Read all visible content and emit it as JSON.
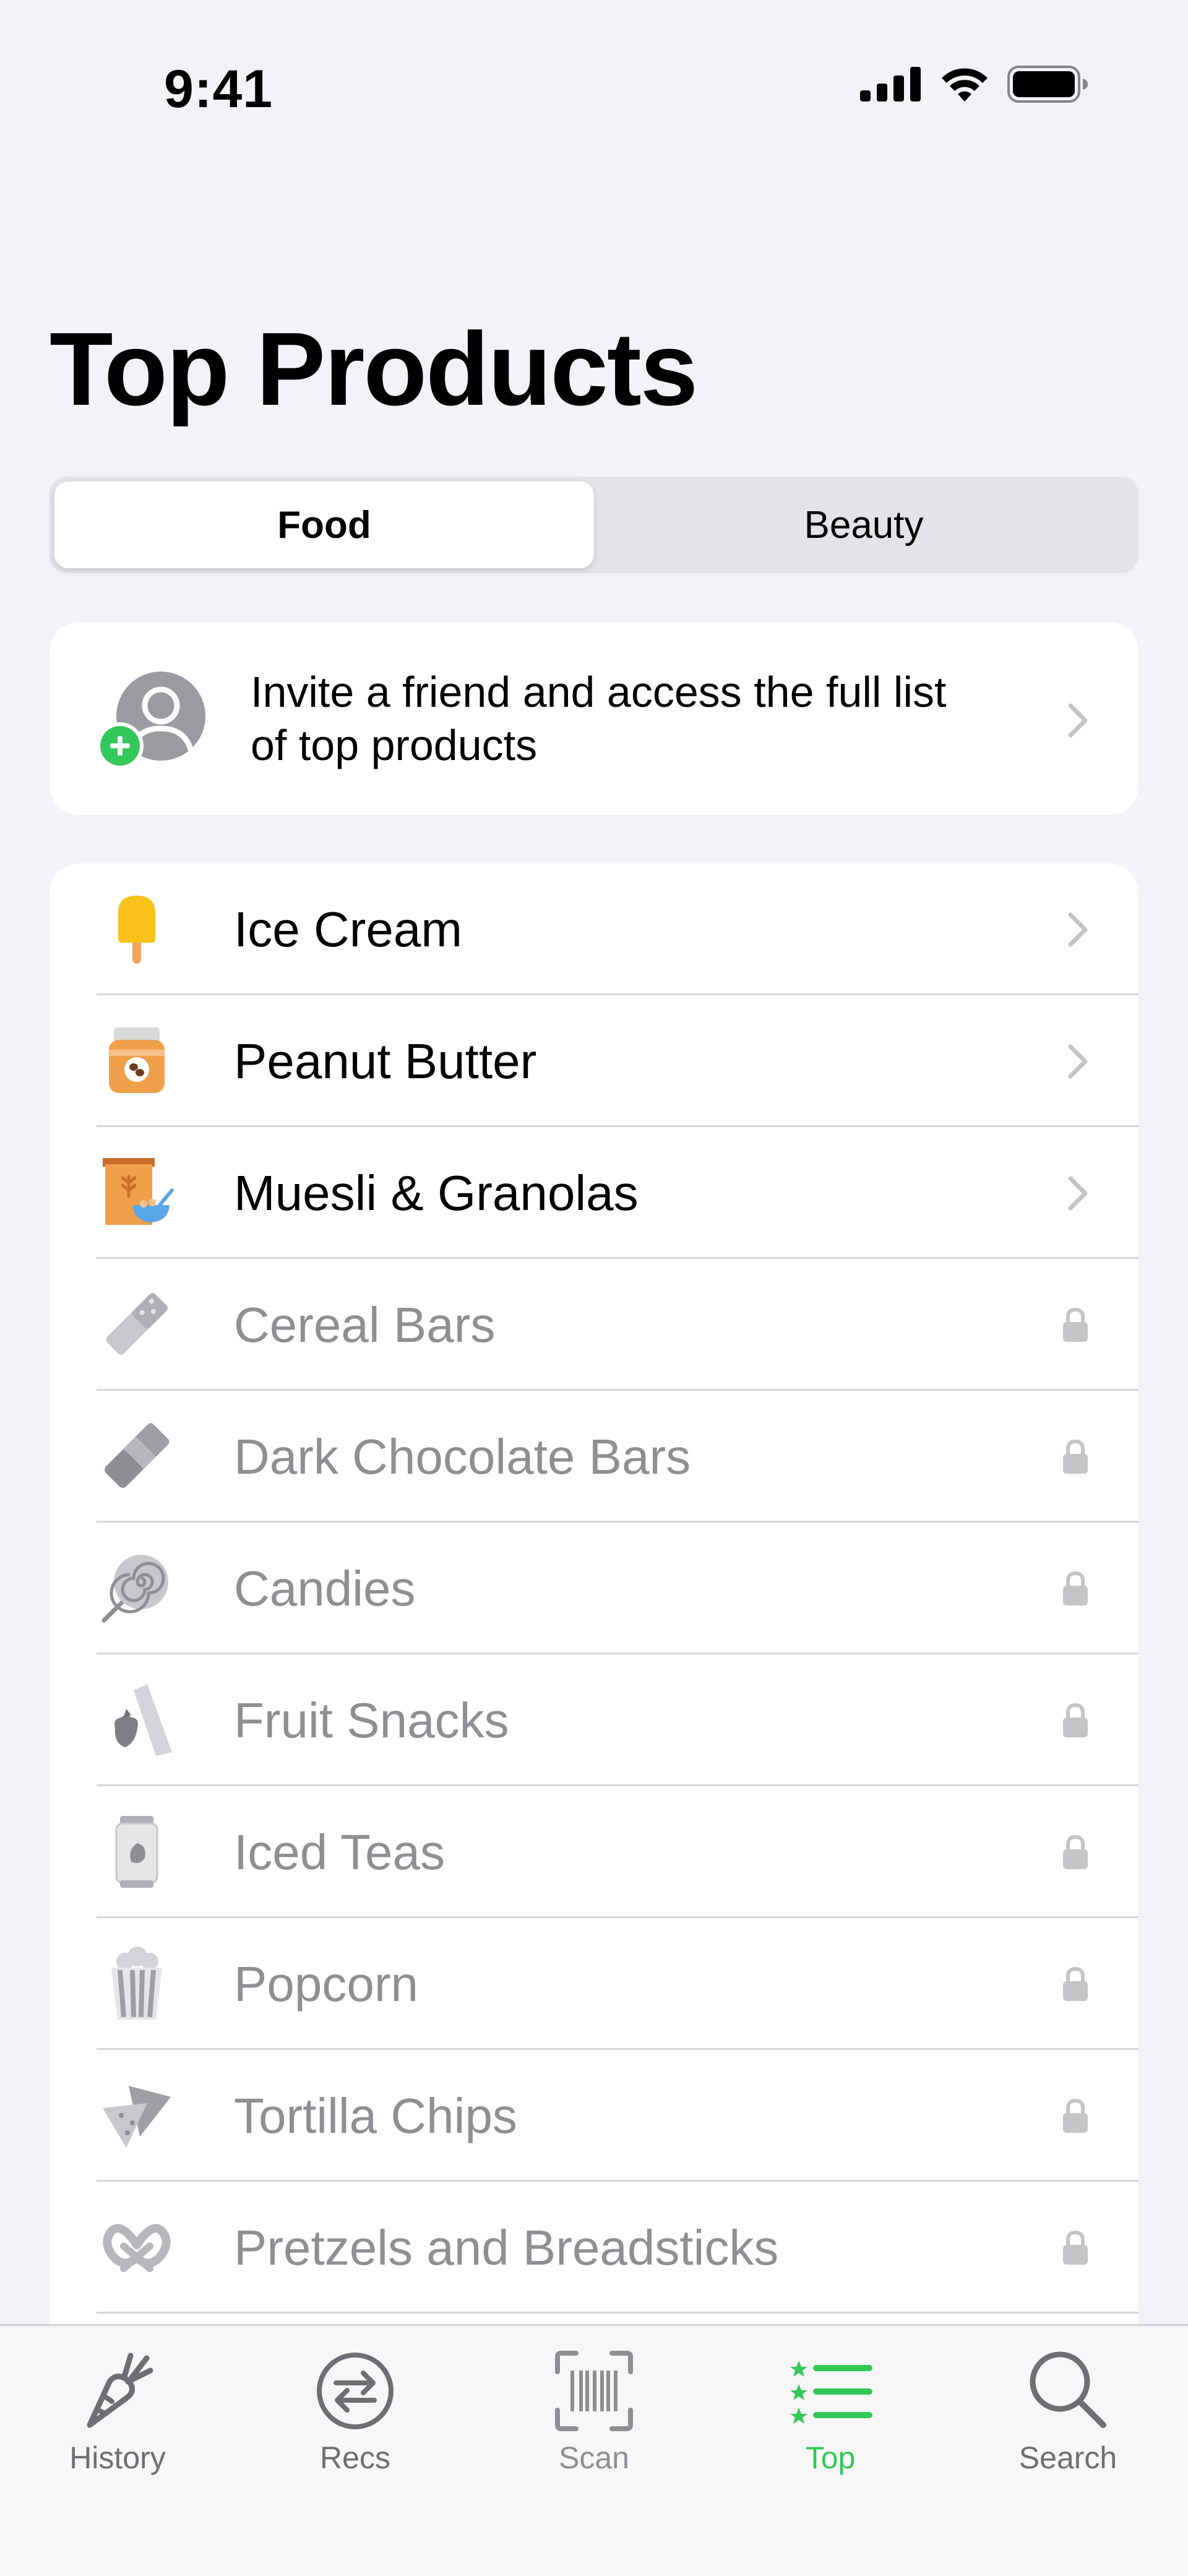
{
  "status_bar": {
    "time": "9:41"
  },
  "page": {
    "title": "Top Products"
  },
  "segments": {
    "food": "Food",
    "beauty": "Beauty",
    "selected": "Food"
  },
  "invite": {
    "line1": "Invite a friend and access the full list",
    "line2": "of top products"
  },
  "categories": [
    {
      "label": "Ice Cream",
      "icon": "ice-cream-icon",
      "locked": false
    },
    {
      "label": "Peanut Butter",
      "icon": "peanut-butter-jar-icon",
      "locked": false
    },
    {
      "label": "Muesli & Granolas",
      "icon": "muesli-bowl-icon",
      "locked": false
    },
    {
      "label": "Cereal Bars",
      "icon": "cereal-bar-icon",
      "locked": true
    },
    {
      "label": "Dark Chocolate Bars",
      "icon": "chocolate-bar-icon",
      "locked": true
    },
    {
      "label": "Candies",
      "icon": "lollipop-icon",
      "locked": true
    },
    {
      "label": "Fruit Snacks",
      "icon": "fruit-snack-icon",
      "locked": true
    },
    {
      "label": "Iced Teas",
      "icon": "iced-tea-can-icon",
      "locked": true
    },
    {
      "label": "Popcorn",
      "icon": "popcorn-icon",
      "locked": true
    },
    {
      "label": "Tortilla Chips",
      "icon": "tortilla-chips-icon",
      "locked": true
    },
    {
      "label": "Pretzels and Breadsticks",
      "icon": "pretzel-icon",
      "locked": true
    }
  ],
  "tabs": {
    "history": "History",
    "recs": "Recs",
    "scan": "Scan",
    "top": "Top",
    "search": "Search",
    "active": "Top"
  },
  "colors": {
    "accent_green": "#34C759",
    "background": "#F2F2F7",
    "locked_gray": "#8E8E93",
    "ice_cream_yellow": "#F9C21A",
    "jar_orange": "#F0A04B"
  }
}
